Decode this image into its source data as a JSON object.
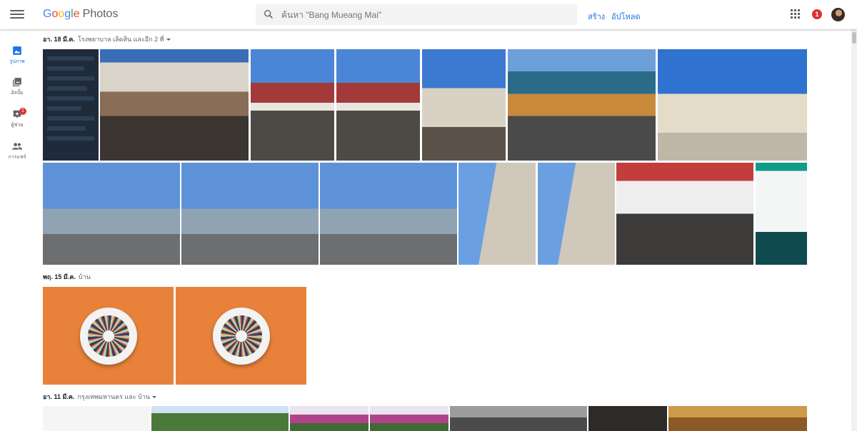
{
  "app": {
    "logo_letters": [
      "G",
      "o",
      "o",
      "g",
      "l",
      "e"
    ],
    "logo_suffix": "Photos"
  },
  "search": {
    "placeholder": "ค้นหา \"Bang Mueang Mai\""
  },
  "header": {
    "create_label": "สร้าง",
    "upload_label": "อัปโหลด",
    "notification_count": "1"
  },
  "sidebar": {
    "items": [
      {
        "label": "รูปภาพ",
        "icon": "photo-icon",
        "active": true
      },
      {
        "label": "อัลบั้ม",
        "icon": "album-icon",
        "active": false
      },
      {
        "label": "ผู้ช่วย",
        "icon": "assistant-icon",
        "active": false,
        "badge": "1"
      },
      {
        "label": "การแชร์",
        "icon": "people-icon",
        "active": false
      }
    ]
  },
  "sections": [
    {
      "date": "อา. 18 มี.ค.",
      "place": "โรงพยาบาล เลิดสิน และอีก 2 ที่",
      "has_menu": true
    },
    {
      "date": "พฤ. 15 มี.ค.",
      "place": "บ้าน",
      "has_menu": false
    },
    {
      "date": "อา. 11 มี.ค.",
      "place": "กรุงเทพมหานคร และ บ้าน",
      "has_menu": true
    }
  ],
  "colors": {
    "accent": "#1a73e8",
    "badge_red": "#db3236",
    "google_blue": "#4285F4",
    "google_red": "#EA4335",
    "google_yellow": "#FBBC05",
    "google_green": "#34A853"
  }
}
